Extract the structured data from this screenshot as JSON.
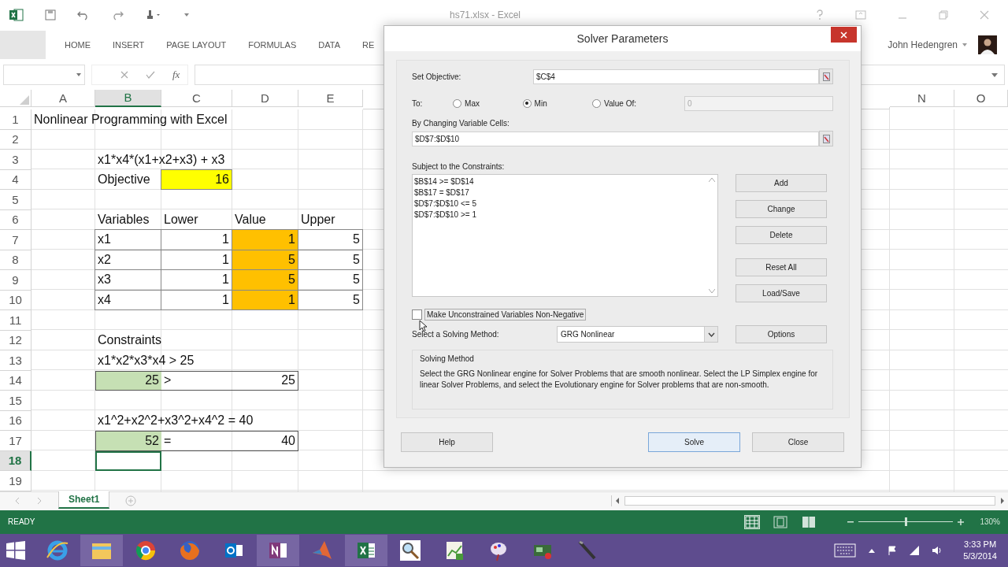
{
  "title_bar": {
    "file_name": "hs71.xlsx - Excel",
    "user": "John Hedengren"
  },
  "ribbon_tabs": [
    {
      "label": "HOME",
      "selected": false
    },
    {
      "label": "INSERT",
      "selected": false
    },
    {
      "label": "PAGE LAYOUT",
      "selected": false
    },
    {
      "label": "FORMULAS",
      "selected": false
    },
    {
      "label": "DATA",
      "selected": false
    },
    {
      "label": "RE",
      "selected": false
    }
  ],
  "formula_bar": {
    "function_label": "fx"
  },
  "sheet": {
    "columns": [
      {
        "label": "A",
        "selected": false
      },
      {
        "label": "B",
        "selected": true
      },
      {
        "label": "C",
        "selected": false
      },
      {
        "label": "D",
        "selected": false
      },
      {
        "label": "E",
        "selected": false
      },
      {
        "label": "N",
        "selected": false
      },
      {
        "label": "O",
        "selected": false
      }
    ],
    "rows": [
      {
        "number": "1",
        "selected": false,
        "cells": {
          "A": {
            "kind": "text",
            "text": "Nonlinear Programming with Excel"
          }
        }
      },
      {
        "number": "2",
        "selected": false
      },
      {
        "number": "3",
        "selected": false,
        "cells": {
          "B": {
            "kind": "text",
            "text": "x1*x4*(x1+x2+x3) + x3"
          }
        }
      },
      {
        "number": "4",
        "selected": false,
        "cells": {
          "B": {
            "kind": "text",
            "text": "Objective"
          },
          "C": {
            "kind": "number",
            "text": "16",
            "color": "#ffff00",
            "outlined": true
          }
        }
      },
      {
        "number": "5",
        "selected": false
      },
      {
        "number": "6",
        "selected": false,
        "cells": {
          "B": {
            "kind": "text",
            "text": "Variables"
          },
          "C": {
            "kind": "text",
            "text": "Lower"
          },
          "D": {
            "kind": "text",
            "text": "Value"
          },
          "E": {
            "kind": "text",
            "text": "Upper"
          }
        }
      },
      {
        "number": "7",
        "selected": false,
        "grid_border": true,
        "cells": {
          "B": {
            "kind": "text",
            "text": "x1"
          },
          "C": {
            "kind": "number",
            "text": "1"
          },
          "D": {
            "kind": "number",
            "text": "1",
            "color": "#ffc000"
          },
          "E": {
            "kind": "number",
            "text": "5"
          }
        }
      },
      {
        "number": "8",
        "selected": false,
        "grid_border": true,
        "cells": {
          "B": {
            "kind": "text",
            "text": "x2"
          },
          "C": {
            "kind": "number",
            "text": "1"
          },
          "D": {
            "kind": "number",
            "text": "5",
            "color": "#ffc000"
          },
          "E": {
            "kind": "number",
            "text": "5"
          }
        }
      },
      {
        "number": "9",
        "selected": false,
        "grid_border": true,
        "cells": {
          "B": {
            "kind": "text",
            "text": "x3"
          },
          "C": {
            "kind": "number",
            "text": "1"
          },
          "D": {
            "kind": "number",
            "text": "5",
            "color": "#ffc000"
          },
          "E": {
            "kind": "number",
            "text": "5"
          }
        }
      },
      {
        "number": "10",
        "selected": false,
        "grid_border": true,
        "cells": {
          "B": {
            "kind": "text",
            "text": "x4"
          },
          "C": {
            "kind": "number",
            "text": "1"
          },
          "D": {
            "kind": "number",
            "text": "1",
            "color": "#ffc000"
          },
          "E": {
            "kind": "number",
            "text": "5"
          }
        }
      },
      {
        "number": "11",
        "selected": false
      },
      {
        "number": "12",
        "selected": false,
        "cells": {
          "B": {
            "kind": "text",
            "text": "Constraints"
          }
        }
      },
      {
        "number": "13",
        "selected": false,
        "cells": {
          "B": {
            "kind": "text",
            "text": "x1*x2*x3*x4 > 25"
          }
        }
      },
      {
        "number": "14",
        "selected": false,
        "boxed": true,
        "cells": {
          "B": {
            "kind": "number",
            "text": "25",
            "color": "#c6e0b4"
          },
          "C": {
            "kind": "text",
            "text": ">"
          },
          "D": {
            "kind": "number",
            "text": "25"
          }
        }
      },
      {
        "number": "15",
        "selected": false
      },
      {
        "number": "16",
        "selected": false,
        "cells": {
          "B": {
            "kind": "text",
            "text": "x1^2+x2^2+x3^2+x4^2 = 40"
          }
        }
      },
      {
        "number": "17",
        "selected": false,
        "boxed": true,
        "cells": {
          "B": {
            "kind": "number",
            "text": "52",
            "color": "#c6e0b4"
          },
          "C": {
            "kind": "text",
            "text": "="
          },
          "D": {
            "kind": "number",
            "text": "40"
          }
        }
      },
      {
        "number": "18",
        "selected": true
      },
      {
        "number": "19",
        "selected": false
      }
    ]
  },
  "sheet_tabs": [
    {
      "label": "Sheet1",
      "selected": true
    }
  ],
  "status_bar": {
    "status": "READY",
    "views": [
      {
        "kind": "normal",
        "selected": true
      },
      {
        "kind": "page-layout",
        "selected": false
      },
      {
        "kind": "page-break",
        "selected": false
      }
    ],
    "zoom": {
      "level": 0.5,
      "reading": "130%"
    }
  },
  "taskbar": {
    "apps": [
      {
        "kind": "ie",
        "active": false
      },
      {
        "kind": "folder",
        "active": true
      },
      {
        "kind": "chrome",
        "active": false
      },
      {
        "kind": "firefox",
        "active": false
      },
      {
        "kind": "outlook",
        "active": false
      },
      {
        "kind": "onenote",
        "active": true
      },
      {
        "kind": "matlab",
        "active": false
      },
      {
        "kind": "excel",
        "active": true
      },
      {
        "kind": "magnifier",
        "active": false
      },
      {
        "kind": "chart",
        "active": false
      },
      {
        "kind": "paint",
        "active": false
      },
      {
        "kind": "network",
        "active": false
      },
      {
        "kind": "pen",
        "active": false
      }
    ],
    "time": "3:33 PM",
    "date": "5/3/2014"
  },
  "dialog": {
    "title": "Solver Parameters",
    "objective": {
      "label": "Set Objective:",
      "value": "$C$4"
    },
    "to": {
      "label": "To:",
      "options": [
        {
          "label": "Max",
          "selected": false
        },
        {
          "label": "Min",
          "selected": true
        },
        {
          "label": "Value Of:",
          "selected": false
        }
      ],
      "value_of": {
        "value": "0",
        "disabled": true
      }
    },
    "changing": {
      "label": "By Changing Variable Cells:",
      "value": "$D$7:$D$10"
    },
    "constraints": {
      "label": "Subject to the Constraints:",
      "items": [
        "$B$14 >= $D$14",
        "$B$17 = $D$17",
        "$D$7:$D$10 <= 5",
        "$D$7:$D$10 >= 1"
      ]
    },
    "side_buttons": [
      {
        "label": "Add",
        "kind": "top"
      },
      {
        "label": "Change",
        "kind": "top"
      },
      {
        "label": "Delete",
        "kind": "top"
      },
      {
        "label": "Reset All",
        "kind": "bottom"
      },
      {
        "label": "Load/Save",
        "kind": "bottom"
      }
    ],
    "non_negative": {
      "label": "Make Unconstrained Variables Non-Negative",
      "checked": false
    },
    "method": {
      "label": "Select a Solving Method:",
      "value": "GRG Nonlinear",
      "button": "Options"
    },
    "method_info": {
      "title": "Solving Method",
      "text": "Select the GRG Nonlinear engine for Solver Problems that are smooth nonlinear. Select the LP Simplex engine for linear Solver Problems, and select the Evolutionary engine for Solver problems that are non-smooth."
    },
    "footer_buttons": [
      {
        "label": "Help",
        "focused": false
      },
      {
        "label": "Solve",
        "focused": true
      },
      {
        "label": "Close",
        "focused": false
      }
    ]
  }
}
